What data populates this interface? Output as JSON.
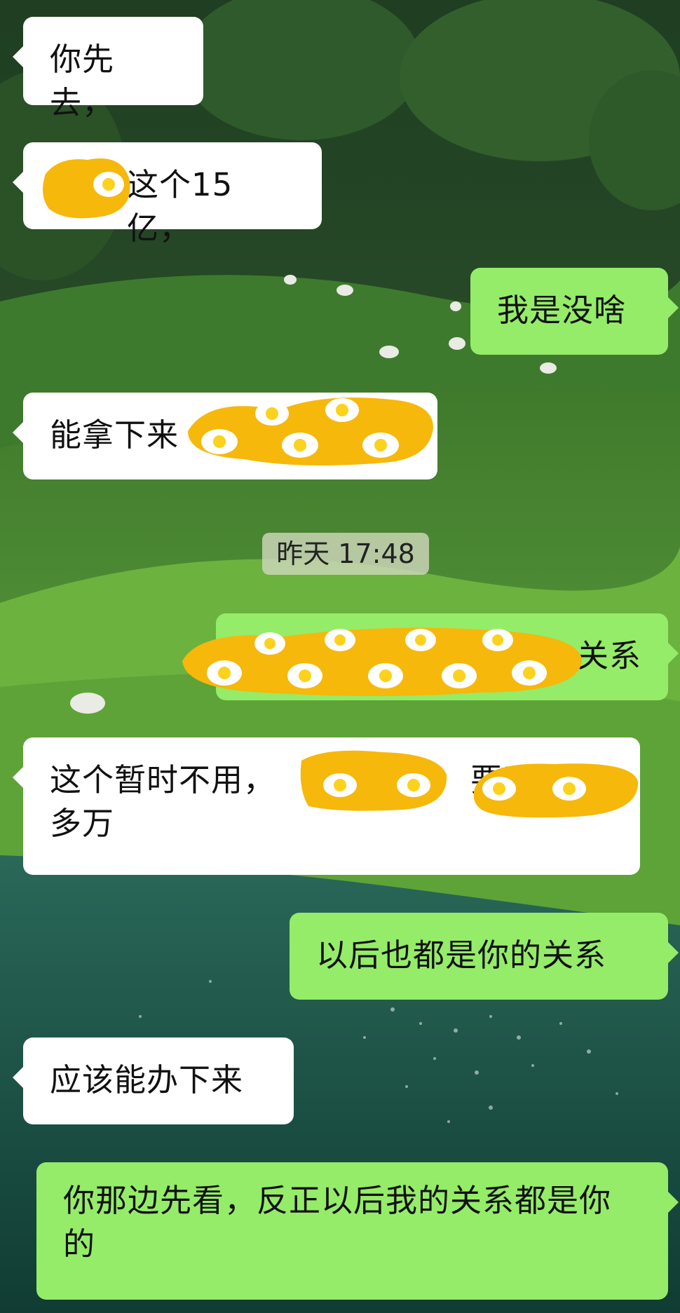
{
  "colors": {
    "incoming_bubble": "#ffffff",
    "outgoing_bubble": "#95ec69",
    "redaction_fill": "#f6b80a",
    "egg_white": "#ffffff",
    "egg_yolk": "#fcd21c",
    "sky": "#2c4d2c",
    "grass": "#5fa536",
    "water": "#1c5a4a"
  },
  "chat": {
    "messages": [
      {
        "side": "incoming",
        "text": "你先去，"
      },
      {
        "side": "incoming",
        "text": "这个15亿，",
        "partially_redacted": true
      },
      {
        "side": "outgoing",
        "text": "我是没啥"
      },
      {
        "side": "incoming",
        "text": "能拿下来",
        "partially_redacted": true
      },
      {
        "side": "timestamp",
        "text": "昨天 17:48"
      },
      {
        "side": "outgoing",
        "text": "关系",
        "partially_redacted": true
      },
      {
        "side": "incoming",
        "line1_a": "这个暂时不用，",
        "line1_b": "要了",
        "line2": "多万",
        "partially_redacted": true
      },
      {
        "side": "outgoing",
        "text": "以后也都是你的关系"
      },
      {
        "side": "incoming",
        "text": "应该能办下来"
      },
      {
        "side": "outgoing",
        "text": "你那边先看，反正以后我的关系都是你的"
      }
    ]
  },
  "decorations": {
    "redaction_sticker": "fried-egg-sticker-icon",
    "sheep_icon": "sheep-icon"
  }
}
